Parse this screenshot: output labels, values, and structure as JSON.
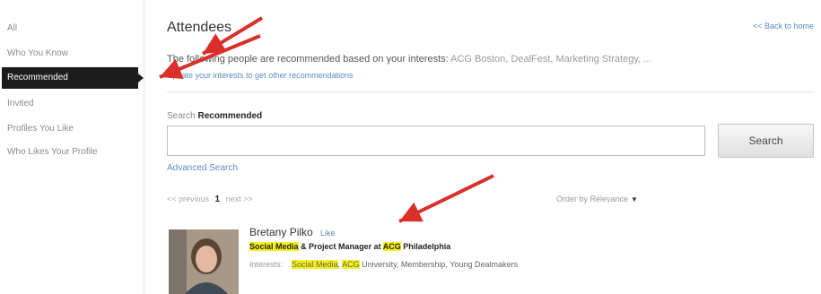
{
  "sidebar": {
    "items": [
      "All",
      "Who You Know",
      "Recommended",
      "Invited",
      "Profiles You Like",
      "Who Likes Your Profile"
    ],
    "active_index": 2
  },
  "main": {
    "title": "Attendees",
    "back_link": "<< Back to home",
    "intro_text": "The following people are recommended based on your interests:",
    "intro_interests": "ACG Boston, DealFest, Marketing Strategy, ...",
    "update_link": "Update your interests to get other recommendations"
  },
  "search": {
    "label_prefix": "Search",
    "label_scope": "Recommended",
    "value": "",
    "button_label": "Search",
    "advanced_link": "Advanced Search"
  },
  "pagination": {
    "previous": "<< previous",
    "current": "1",
    "next": "next >>"
  },
  "order": {
    "label": "Order by Relevance"
  },
  "result": {
    "name": "Bretany Pilko",
    "like_link": "Like",
    "headline_parts": [
      "Social Media",
      " & ",
      "Project Manager at ",
      "ACG",
      " Philadelphia"
    ],
    "interests_label": "Interests:",
    "interests_parts": [
      "Social Media",
      ", ",
      "ACG",
      " University, Membership, Young Dealmakers"
    ]
  },
  "colors": {
    "active_nav_bg": "#1c1c1c",
    "link": "#5b8cc4",
    "highlight": "#f5f01c",
    "annotation_arrow": "#d9302a"
  }
}
